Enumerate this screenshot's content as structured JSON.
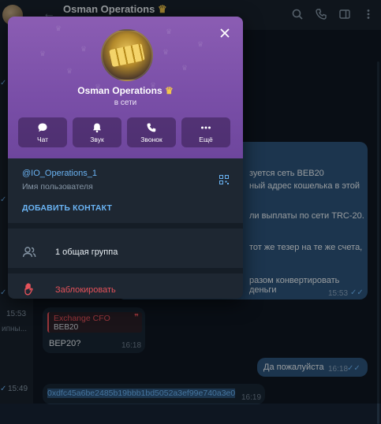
{
  "chat_header": {
    "title": "Osman Operations",
    "verified_icon": "crown-icon"
  },
  "sidebar": {
    "times": [
      "15:53",
      "15:49"
    ],
    "snippet": "ипны..."
  },
  "messages": {
    "out_fragments": [
      "зуется сеть BEB20",
      "ный адрес кошелька в этой",
      "ли выплаты по сети TRC-20.",
      "тот же тезер на те же счета,",
      "разом конвертировать деньги"
    ],
    "out_time": "15:53",
    "reply": {
      "quote_author": "Exchange CFO",
      "quote_text": "BEB20",
      "text": "BEP20?",
      "time": "16:18"
    },
    "out_short": {
      "text": "Да пожалуйста",
      "time": "16:18"
    },
    "address": {
      "text": "0xdfc45a6be2485b19bbb1bd5052a3ef99e740a3e0",
      "time": "16:19"
    }
  },
  "profile_card": {
    "name": "Osman Operations",
    "status": "в сети",
    "actions": [
      {
        "label": "Чат",
        "icon": "chat-icon"
      },
      {
        "label": "Звук",
        "icon": "bell-icon"
      },
      {
        "label": "Звонок",
        "icon": "phone-icon"
      },
      {
        "label": "Ещё",
        "icon": "more-icon"
      }
    ],
    "username": "@IO_Operations_1",
    "username_caption": "Имя пользователя",
    "add_contact": "ДОБАВИТЬ КОНТАКТ",
    "groups": "1 общая группа",
    "block": "Заблокировать"
  },
  "colors": {
    "hero": "#7a4fa8",
    "accent": "#6ab3f3",
    "danger": "#e5525a",
    "outgoing": "#2b5278",
    "incoming": "#182533"
  }
}
